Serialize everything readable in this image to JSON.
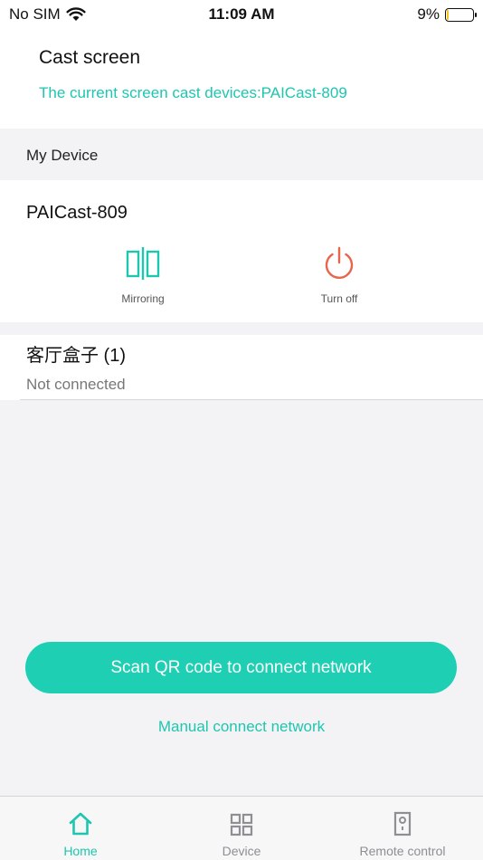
{
  "status_bar": {
    "carrier": "No SIM",
    "time": "11:09 AM",
    "battery_text": "9%",
    "battery_level": 0.09,
    "battery_color": "#f5c518"
  },
  "header": {
    "title": "Cast screen",
    "subtitle": "The current screen cast devices:PAICast-809"
  },
  "my_device": {
    "section_label": "My Device",
    "name": "PAICast-809",
    "actions": {
      "mirroring": {
        "label": "Mirroring",
        "icon": "mirroring-icon",
        "color": "#1ec6b0"
      },
      "turn_off": {
        "label": "Turn off",
        "icon": "power-icon",
        "color": "#e8654a"
      }
    }
  },
  "other_device": {
    "name": "客厅盒子 (1)",
    "status": "Not connected"
  },
  "scan_button": {
    "label": "Scan QR code to connect network"
  },
  "manual_link": {
    "label": "Manual connect network"
  },
  "tabs": [
    {
      "label": "Home",
      "icon": "home-icon",
      "active": true
    },
    {
      "label": "Device",
      "icon": "grid-icon",
      "active": false
    },
    {
      "label": "Remote control",
      "icon": "remote-icon",
      "active": false
    }
  ],
  "colors": {
    "accent": "#1ecfb3",
    "accent_text": "#1ec6b0",
    "danger": "#e8654a"
  }
}
